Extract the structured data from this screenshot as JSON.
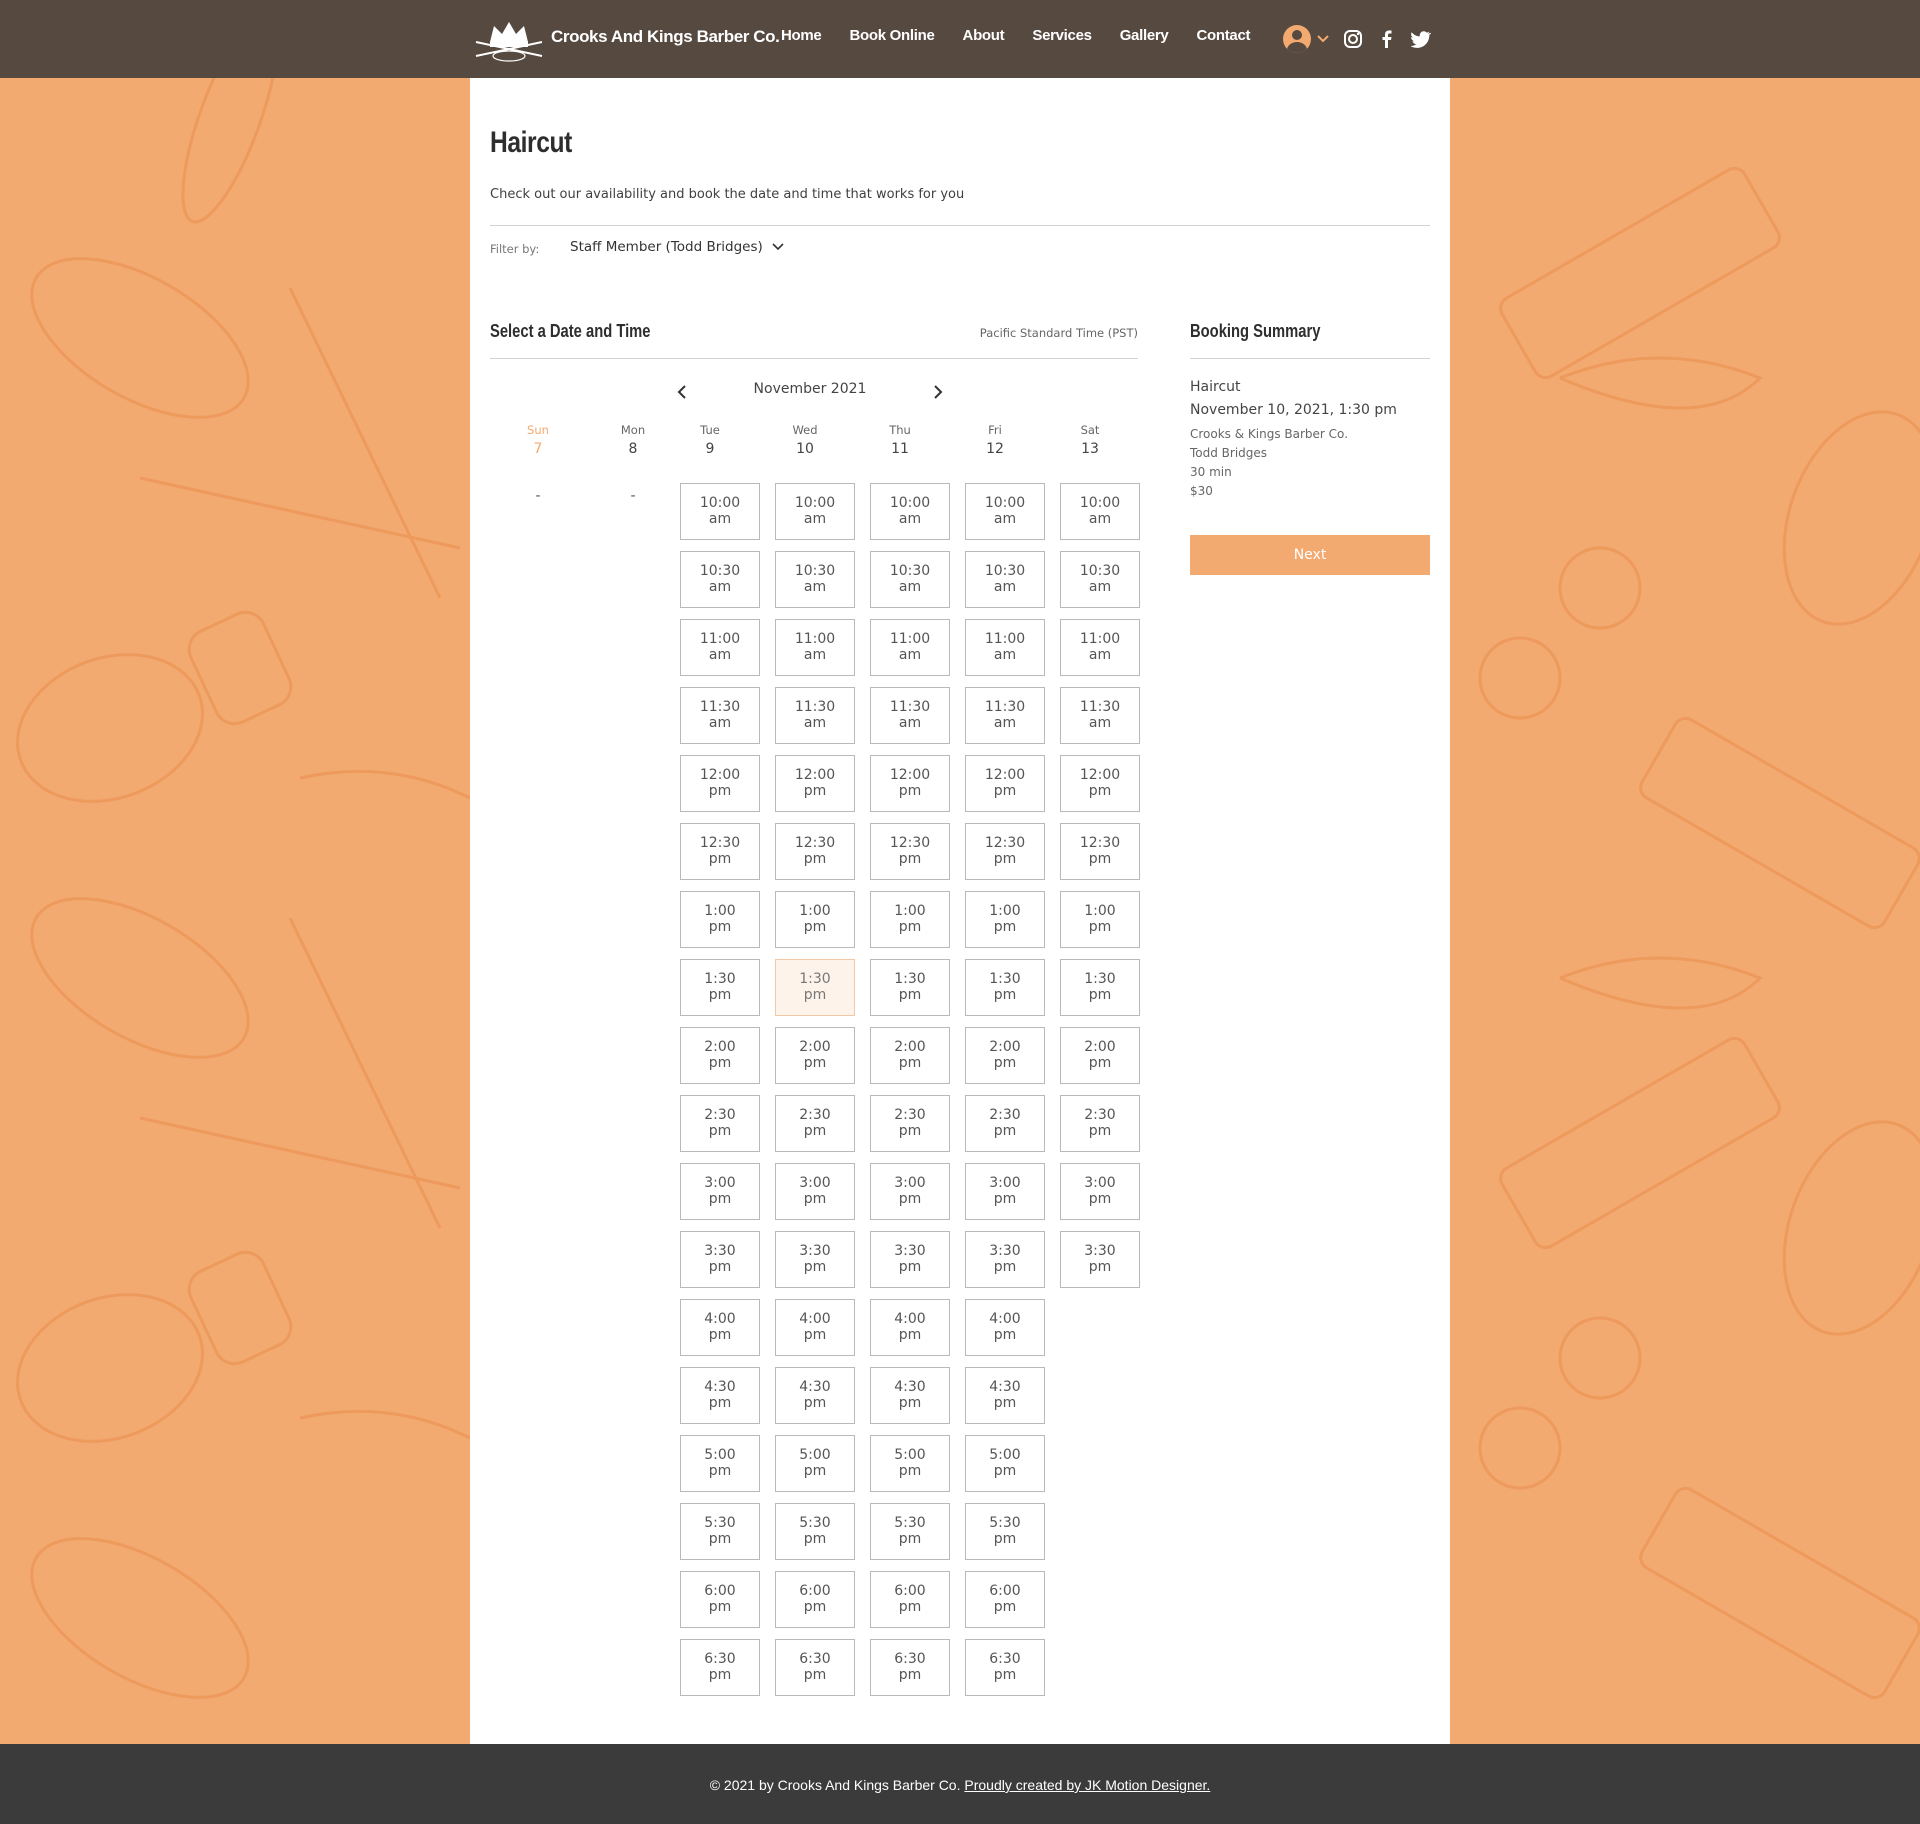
{
  "header": {
    "brand": "Crooks And Kings Barber Co.",
    "nav": [
      "Home",
      "Book Online",
      "About",
      "Services",
      "Gallery",
      "Contact"
    ],
    "icons": [
      "user-icon",
      "chevron-down-icon",
      "instagram-icon",
      "facebook-icon",
      "twitter-icon"
    ]
  },
  "page": {
    "title": "Haircut",
    "subtitle": "Check out our availability and book the date and time that works for you",
    "filter_label": "Filter by:",
    "filter_value": "Staff Member (Todd Bridges)"
  },
  "calendar": {
    "section_title": "Select a Date and Time",
    "timezone": "Pacific Standard Time (PST)",
    "month": "November 2021",
    "days": [
      {
        "name": "Sun",
        "num": "7"
      },
      {
        "name": "Mon",
        "num": "8"
      },
      {
        "name": "Tue",
        "num": "9"
      },
      {
        "name": "Wed",
        "num": "10"
      },
      {
        "name": "Thu",
        "num": "11"
      },
      {
        "name": "Fri",
        "num": "12"
      },
      {
        "name": "Sat",
        "num": "13"
      }
    ],
    "no_slots_text": "-",
    "times": [
      "10:00 am",
      "10:30 am",
      "11:00 am",
      "11:30 am",
      "12:00 pm",
      "12:30 pm",
      "1:00 pm",
      "1:30 pm",
      "2:00 pm",
      "2:30 pm",
      "3:00 pm",
      "3:30 pm",
      "4:00 pm",
      "4:30 pm",
      "5:00 pm",
      "5:30 pm",
      "6:00 pm",
      "6:30 pm"
    ],
    "available": {
      "Tue": 18,
      "Wed": 18,
      "Thu": 18,
      "Fri": 18,
      "Sat": 12
    },
    "selected": {
      "day": "Wed",
      "time": "1:30 pm"
    }
  },
  "summary": {
    "title": "Booking Summary",
    "service": "Haircut",
    "datetime": "November 10, 2021, 1:30 pm",
    "location": "Crooks & Kings Barber Co.",
    "staff": "Todd Bridges",
    "duration": "30 min",
    "price": "$30",
    "next_label": "Next"
  },
  "footer": {
    "text": "© 2021 by Crooks And Kings Barber Co.",
    "link": "Proudly created by JK Motion Designer."
  },
  "colors": {
    "accent": "#f3aa70",
    "header_bg": "#564940",
    "footer_bg": "#3b3b3b",
    "pattern_stroke": "#e88c4e"
  }
}
